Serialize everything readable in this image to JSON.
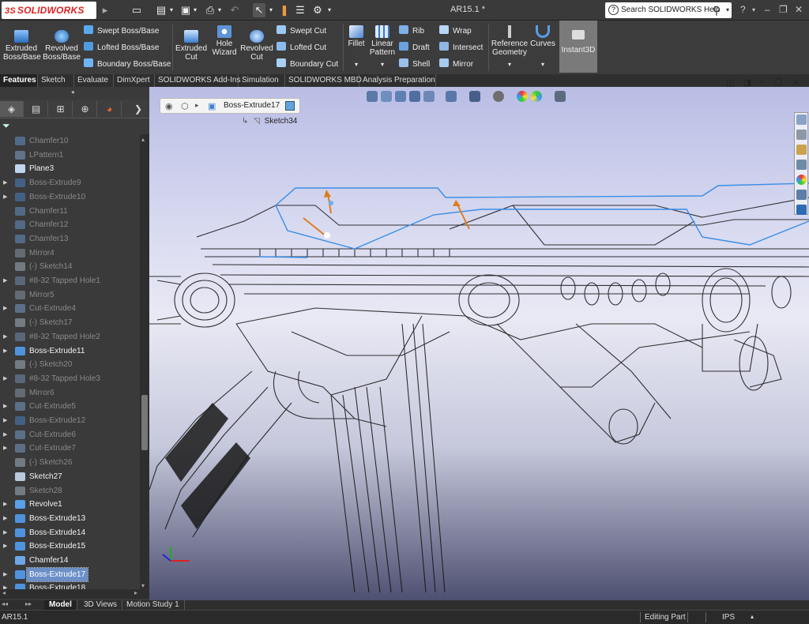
{
  "app": {
    "logo_text_ds": "3S",
    "logo_text_solid": "SOLID",
    "logo_text_works": "WORKS",
    "document_title": "AR15.1 *",
    "search_placeholder": "Search SOLIDWORKS Help",
    "search_help_glyph": "?"
  },
  "quick_access": [
    "New",
    "Open",
    "Save",
    "Print",
    "Undo",
    "Select",
    "Rebuild",
    "File Properties",
    "Options"
  ],
  "command_manager": {
    "large_tools": [
      {
        "id": "extruded-boss",
        "label": "Extruded Boss/Base"
      },
      {
        "id": "revolved-boss",
        "label": "Revolved Boss/Base"
      },
      {
        "id": "extruded-cut",
        "label": "Extruded Cut"
      },
      {
        "id": "hole-wizard",
        "label": "Hole Wizard"
      },
      {
        "id": "revolved-cut",
        "label": "Revolved Cut"
      },
      {
        "id": "fillet",
        "label": "Fillet"
      },
      {
        "id": "linear-pattern",
        "label": "Linear Pattern"
      },
      {
        "id": "reference-geometry",
        "label": "Reference Geometry"
      },
      {
        "id": "curves",
        "label": "Curves"
      },
      {
        "id": "instant3d",
        "label": "Instant3D"
      }
    ],
    "small_tools": {
      "swept_boss": "Swept Boss/Base",
      "lofted_boss": "Lofted Boss/Base",
      "boundary_boss": "Boundary Boss/Base",
      "swept_cut": "Swept Cut",
      "lofted_cut": "Lofted Cut",
      "boundary_cut": "Boundary Cut",
      "rib": "Rib",
      "draft": "Draft",
      "shell": "Shell",
      "wrap": "Wrap",
      "intersect": "Intersect",
      "mirror": "Mirror"
    }
  },
  "tabs": [
    "Features",
    "Sketch",
    "Evaluate",
    "DimXpert",
    "SOLIDWORKS Add-Ins",
    "Simulation",
    "SOLIDWORKS MBD",
    "Analysis Preparation"
  ],
  "active_tab": "Features",
  "feature_tree": [
    {
      "label": "Chamfer10",
      "state": "dim",
      "expandable": false,
      "icon": "chamfer-icon"
    },
    {
      "label": "LPattern1",
      "state": "dim",
      "expandable": false,
      "icon": "pattern-icon"
    },
    {
      "label": "Plane3",
      "state": "bright",
      "expandable": false,
      "icon": "plane-icon"
    },
    {
      "label": "Boss-Extrude9",
      "state": "dim",
      "expandable": true,
      "icon": "extrude-icon"
    },
    {
      "label": "Boss-Extrude10",
      "state": "dim",
      "expandable": true,
      "icon": "extrude-icon"
    },
    {
      "label": "Chamfer11",
      "state": "dim",
      "expandable": false,
      "icon": "chamfer-icon"
    },
    {
      "label": "Chamfer12",
      "state": "dim",
      "expandable": false,
      "icon": "chamfer-icon"
    },
    {
      "label": "Chamfer13",
      "state": "dim",
      "expandable": false,
      "icon": "chamfer-icon"
    },
    {
      "label": "Mirror4",
      "state": "dim",
      "expandable": false,
      "icon": "mirror-icon"
    },
    {
      "label": "(-) Sketch14",
      "state": "dim",
      "expandable": false,
      "icon": "sketch-icon"
    },
    {
      "label": "#8-32 Tapped Hole1",
      "state": "dim",
      "expandable": true,
      "icon": "hole-icon"
    },
    {
      "label": "Mirror5",
      "state": "dim",
      "expandable": false,
      "icon": "mirror-icon"
    },
    {
      "label": "Cut-Extrude4",
      "state": "dim",
      "expandable": true,
      "icon": "cut-icon"
    },
    {
      "label": "(-) Sketch17",
      "state": "dim",
      "expandable": false,
      "icon": "sketch-icon"
    },
    {
      "label": "#8-32 Tapped Hole2",
      "state": "dim",
      "expandable": true,
      "icon": "hole-icon"
    },
    {
      "label": "Boss-Extrude11",
      "state": "bright",
      "expandable": true,
      "icon": "extrude-icon"
    },
    {
      "label": "(-) Sketch20",
      "state": "dim",
      "expandable": false,
      "icon": "sketch-icon"
    },
    {
      "label": "#8-32 Tapped Hole3",
      "state": "dim",
      "expandable": true,
      "icon": "hole-icon"
    },
    {
      "label": "Mirror6",
      "state": "dim",
      "expandable": false,
      "icon": "mirror-icon"
    },
    {
      "label": "Cut-Extrude5",
      "state": "dim",
      "expandable": true,
      "icon": "cut-icon"
    },
    {
      "label": "Boss-Extrude12",
      "state": "dim",
      "expandable": true,
      "icon": "extrude-icon"
    },
    {
      "label": "Cut-Extrude6",
      "state": "dim",
      "expandable": true,
      "icon": "cut-icon"
    },
    {
      "label": "Cut-Extrude7",
      "state": "dim",
      "expandable": true,
      "icon": "cut-icon"
    },
    {
      "label": "(-) Sketch26",
      "state": "dim",
      "expandable": false,
      "icon": "sketch-icon"
    },
    {
      "label": "Sketch27",
      "state": "bright",
      "expandable": false,
      "icon": "sketch-icon"
    },
    {
      "label": "Sketch28",
      "state": "dim",
      "expandable": false,
      "icon": "sketch-icon"
    },
    {
      "label": "Revolve1",
      "state": "bright",
      "expandable": true,
      "icon": "revolve-icon"
    },
    {
      "label": "Boss-Extrude13",
      "state": "bright",
      "expandable": true,
      "icon": "extrude-icon"
    },
    {
      "label": "Boss-Extrude14",
      "state": "bright",
      "expandable": true,
      "icon": "extrude-icon"
    },
    {
      "label": "Boss-Extrude15",
      "state": "bright",
      "expandable": true,
      "icon": "extrude-icon"
    },
    {
      "label": "Chamfer14",
      "state": "bright",
      "expandable": false,
      "icon": "chamfer-icon"
    },
    {
      "label": "Boss-Extrude17",
      "state": "selected",
      "expandable": true,
      "icon": "extrude-icon"
    },
    {
      "label": "Boss-Extrude18",
      "state": "bright",
      "expandable": true,
      "icon": "extrude-icon"
    }
  ],
  "viewport": {
    "breadcrumb_feature": "Boss-Extrude17",
    "breadcrumb_sketch": "Sketch34"
  },
  "bottom_tabs": [
    "Model",
    "3D Views",
    "Motion Study 1"
  ],
  "active_bottom_tab": "Model",
  "status": {
    "doc_name": "AR15.1",
    "mode": "Editing Part",
    "units": "IPS"
  },
  "colors": {
    "selection_blue": "#6c8fc7",
    "sketch_blue": "#3a8ee6",
    "logo_red": "#d22222"
  }
}
